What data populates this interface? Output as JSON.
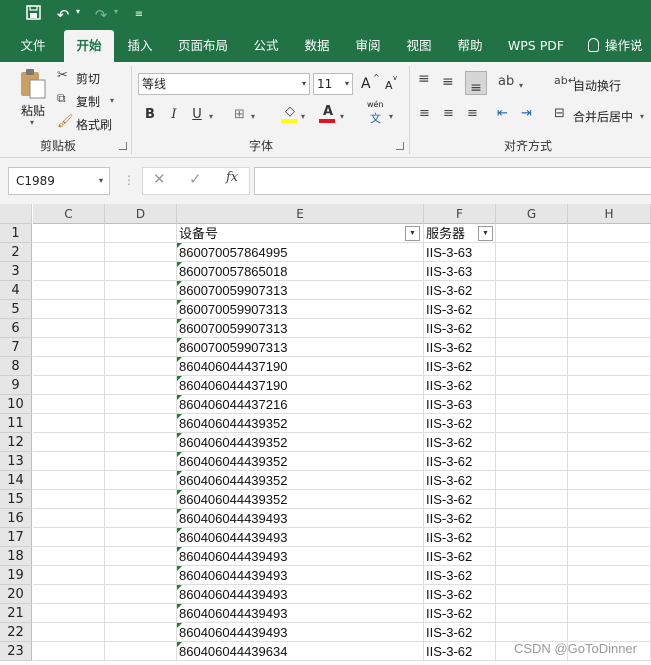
{
  "menu": {
    "tabs": [
      "文件",
      "开始",
      "插入",
      "页面布局",
      "公式",
      "数据",
      "审阅",
      "视图",
      "帮助",
      "WPS PDF",
      "操作说"
    ],
    "active": "开始"
  },
  "ribbon": {
    "clipboard": {
      "paste_label": "粘贴",
      "cut_label": "剪切",
      "copy_label": "复制",
      "format_painter_label": "格式刷",
      "group_label": "剪贴板"
    },
    "font": {
      "font_name": "等线",
      "font_size": "11",
      "grow_label": "A",
      "shrink_label": "A",
      "bold_label": "B",
      "italic_label": "I",
      "underline_label": "U",
      "fill_label": "◇",
      "color_label": "A",
      "phonetic_label": "wén",
      "phonetic_sub": "文",
      "group_label": "字体"
    },
    "alignment": {
      "wrap_label": "自动换行",
      "merge_label": "合并后居中",
      "group_label": "对齐方式"
    }
  },
  "formula_bar": {
    "name_box": "C1989",
    "cancel_icon": "✕",
    "enter_icon": "✓",
    "fx_label": "fx",
    "content": ""
  },
  "sheet": {
    "columns": [
      "C",
      "D",
      "E",
      "F",
      "G",
      "H"
    ],
    "header": {
      "E": "设备号",
      "F": "服务器"
    },
    "row_numbers": [
      "1",
      "2",
      "3",
      "4",
      "5",
      "6",
      "7",
      "8",
      "9",
      "10",
      "11",
      "12",
      "13",
      "14",
      "15",
      "16",
      "17",
      "18",
      "19",
      "20",
      "21",
      "22",
      "23"
    ],
    "rows": [
      [
        "860070057864995",
        "IIS-3-63"
      ],
      [
        "860070057865018",
        "IIS-3-63"
      ],
      [
        "860070059907313",
        "IIS-3-62"
      ],
      [
        "860070059907313",
        "IIS-3-62"
      ],
      [
        "860070059907313",
        "IIS-3-62"
      ],
      [
        "860070059907313",
        "IIS-3-62"
      ],
      [
        "860406044437190",
        "IIS-3-62"
      ],
      [
        "860406044437190",
        "IIS-3-62"
      ],
      [
        "860406044437216",
        "IIS-3-63"
      ],
      [
        "860406044439352",
        "IIS-3-62"
      ],
      [
        "860406044439352",
        "IIS-3-62"
      ],
      [
        "860406044439352",
        "IIS-3-62"
      ],
      [
        "860406044439352",
        "IIS-3-62"
      ],
      [
        "860406044439352",
        "IIS-3-62"
      ],
      [
        "860406044439493",
        "IIS-3-62"
      ],
      [
        "860406044439493",
        "IIS-3-62"
      ],
      [
        "860406044439493",
        "IIS-3-62"
      ],
      [
        "860406044439493",
        "IIS-3-62"
      ],
      [
        "860406044439493",
        "IIS-3-62"
      ],
      [
        "860406044439493",
        "IIS-3-62"
      ],
      [
        "860406044439493",
        "IIS-3-62"
      ],
      [
        "860406044439634",
        "IIS-3-62"
      ]
    ]
  },
  "watermark": "CSDN @GoToDinner",
  "colors": {
    "accent": "#217346",
    "text_marker": "#1e7e34"
  }
}
